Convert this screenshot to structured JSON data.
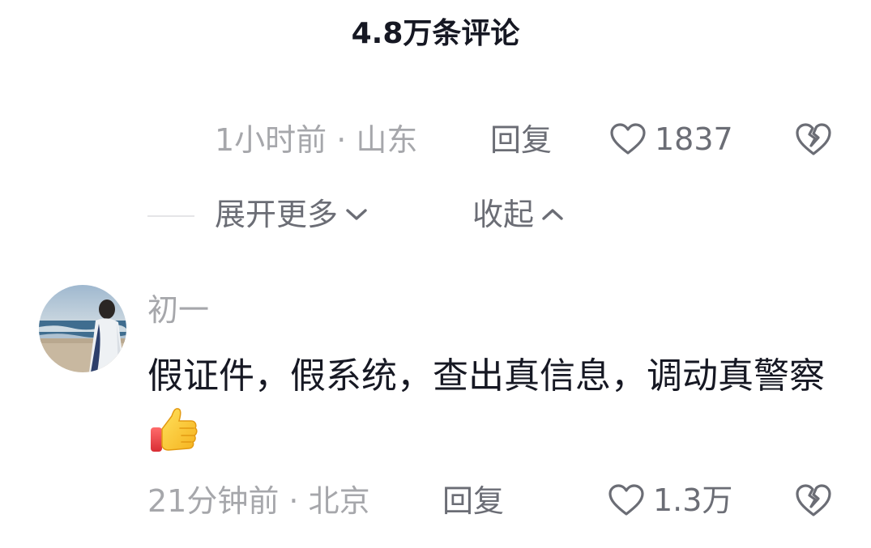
{
  "header": {
    "title": "4.8万条评论"
  },
  "comment_prev": {
    "partial_text": "...",
    "time_location": "1小时前 · 山东",
    "reply_label": "回复",
    "like_count": "1837"
  },
  "thread_controls": {
    "expand_label": "展开更多",
    "collapse_label": "收起"
  },
  "comment_main": {
    "username": "初一",
    "text": "假证件，假系统，查出真信息，调动真警察",
    "emoji": "thumbs-up-icon",
    "time_location": "21分钟前 · 北京",
    "reply_label": "回复",
    "like_count": "1.3万"
  },
  "colors": {
    "primary_text": "#161823",
    "secondary_text": "#a6a7ab",
    "action_text": "#6b6d75"
  }
}
